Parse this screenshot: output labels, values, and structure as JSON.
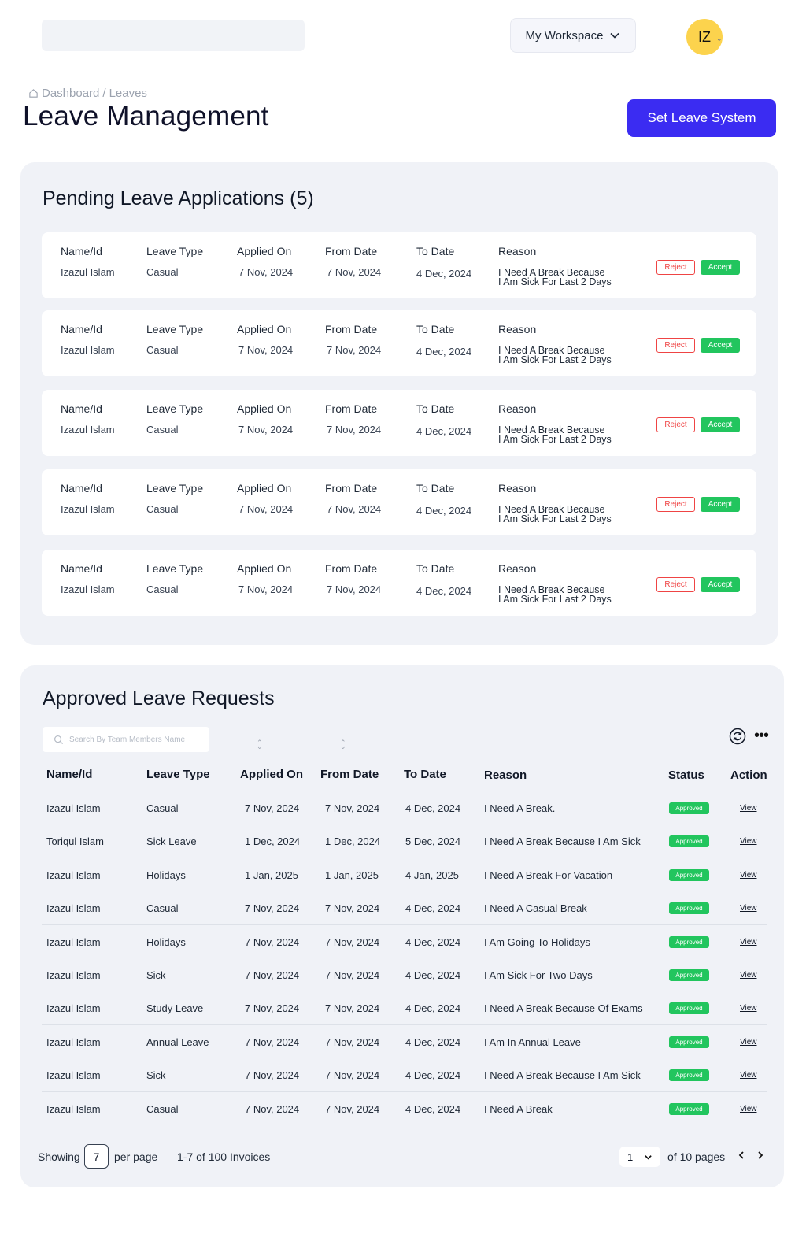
{
  "header": {
    "workspace_label": "My Workspace",
    "avatar_initials": "IZ"
  },
  "breadcrumb": {
    "home": "Dashboard",
    "separator": "/",
    "current": "Leaves"
  },
  "page": {
    "title": "Leave Management",
    "set_leave_button": "Set Leave System"
  },
  "pending": {
    "title": "Pending Leave Applications (5)",
    "headers": {
      "name": "Name/Id",
      "type": "Leave Type",
      "applied": "Applied On",
      "from": "From Date",
      "to": "To Date",
      "reason": "Reason"
    },
    "reject_label": "Reject",
    "accept_label": "Accept",
    "items": [
      {
        "name": "Izazul Islam",
        "type": "Casual",
        "applied": "7 Nov, 2024",
        "from": "7 Nov, 2024",
        "to": "4 Dec, 2024",
        "reason1": "I Need A Break Because",
        "reason2": "I Am Sick For Last 2 Days"
      },
      {
        "name": "Izazul Islam",
        "type": "Casual",
        "applied": "7 Nov, 2024",
        "from": "7 Nov, 2024",
        "to": "4 Dec, 2024",
        "reason1": "I Need A Break Because",
        "reason2": "I Am Sick For Last 2 Days"
      },
      {
        "name": "Izazul Islam",
        "type": "Casual",
        "applied": "7 Nov, 2024",
        "from": "7 Nov, 2024",
        "to": "4 Dec, 2024",
        "reason1": "I Need A Break Because",
        "reason2": "I Am Sick For Last 2 Days"
      },
      {
        "name": "Izazul Islam",
        "type": "Casual",
        "applied": "7 Nov, 2024",
        "from": "7 Nov, 2024",
        "to": "4 Dec, 2024",
        "reason1": "I Need A Break Because",
        "reason2": "I Am Sick For Last 2 Days"
      },
      {
        "name": "Izazul Islam",
        "type": "Casual",
        "applied": "7 Nov, 2024",
        "from": "7 Nov, 2024",
        "to": "4 Dec, 2024",
        "reason1": "I Need A Break Because",
        "reason2": "I Am Sick For Last 2 Days"
      }
    ]
  },
  "approved": {
    "title": "Approved Leave Requests",
    "search_placeholder": "Search By Team Members Name",
    "columns": {
      "name": "Name/Id",
      "type": "Leave Type",
      "applied": "Applied On",
      "from": "From Date",
      "to": "To Date",
      "reason": "Reason",
      "status": "Status",
      "action": "Action"
    },
    "rows": [
      {
        "name": "Izazul Islam",
        "type": "Casual",
        "applied": "7 Nov, 2024",
        "from": "7 Nov, 2024",
        "to": "4 Dec, 2024",
        "reason": "I Need A Break.",
        "status": "Approved",
        "action": "View"
      },
      {
        "name": "Toriqul Islam",
        "type": "Sick Leave",
        "applied": "1 Dec, 2024",
        "from": "1 Dec, 2024",
        "to": "5 Dec, 2024",
        "reason": "I Need A Break Because I Am Sick",
        "status": "Approved",
        "action": "View"
      },
      {
        "name": "Izazul Islam",
        "type": "Holidays",
        "applied": "1 Jan, 2025",
        "from": "1 Jan, 2025",
        "to": "4 Jan, 2025",
        "reason": "I Need A Break For Vacation",
        "status": "Approved",
        "action": "View"
      },
      {
        "name": "Izazul Islam",
        "type": "Casual",
        "applied": "7 Nov, 2024",
        "from": "7 Nov, 2024",
        "to": "4 Dec, 2024",
        "reason": "I Need A Casual Break",
        "status": "Approved",
        "action": "View"
      },
      {
        "name": "Izazul Islam",
        "type": "Holidays",
        "applied": "7 Nov, 2024",
        "from": "7 Nov, 2024",
        "to": "4 Dec, 2024",
        "reason": "I Am Going To Holidays",
        "status": "Approved",
        "action": "View"
      },
      {
        "name": "Izazul Islam",
        "type": "Sick",
        "applied": "7 Nov, 2024",
        "from": "7 Nov, 2024",
        "to": "4 Dec, 2024",
        "reason": "I Am Sick For Two Days",
        "status": "Approved",
        "action": "View"
      },
      {
        "name": "Izazul Islam",
        "type": "Study Leave",
        "applied": "7 Nov, 2024",
        "from": "7 Nov, 2024",
        "to": "4 Dec, 2024",
        "reason": "I Need A Break Because Of Exams",
        "status": "Approved",
        "action": "View"
      },
      {
        "name": "Izazul Islam",
        "type": "Annual Leave",
        "applied": "7 Nov, 2024",
        "from": "7 Nov, 2024",
        "to": "4 Dec, 2024",
        "reason": "I Am In Annual Leave",
        "status": "Approved",
        "action": "View"
      },
      {
        "name": "Izazul Islam",
        "type": "Sick",
        "applied": "7 Nov, 2024",
        "from": "7 Nov, 2024",
        "to": "4 Dec, 2024",
        "reason": "I Need A Break Because I Am Sick",
        "status": "Approved",
        "action": "View"
      },
      {
        "name": "Izazul Islam",
        "type": "Casual",
        "applied": "7 Nov, 2024",
        "from": "7 Nov, 2024",
        "to": "4 Dec, 2024",
        "reason": "I Need A Break",
        "status": "Approved",
        "action": "View"
      }
    ],
    "pagination": {
      "showing_label": "Showing",
      "per_page_value": "7",
      "per_page_label": "per page",
      "range_text": "1-7 of 100 Invoices",
      "current_page": "1",
      "of_pages_text": "of 10 pages"
    }
  },
  "colors": {
    "primary": "#3b2cf2",
    "accept": "#22c55e",
    "reject": "#ef4444",
    "avatar": "#fcd34d",
    "panel_bg": "#f0f2f7"
  }
}
